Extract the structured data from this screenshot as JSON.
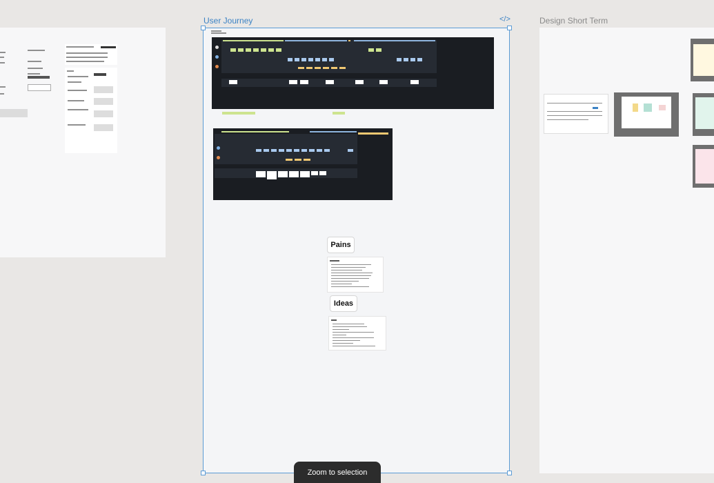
{
  "frames": {
    "user_journey": {
      "label": "User Journey"
    },
    "design_short_term": {
      "label": "Design Short Term"
    }
  },
  "stickies": {
    "pains": "Pains",
    "ideas": "Ideas"
  },
  "toolbar": {
    "zoom_label": "Zoom to selection"
  },
  "icons": {
    "code": "code-icon"
  },
  "colors": {
    "canvas": "#e9e7e5",
    "selection": "#5b9bd5",
    "dark_board": "#1a1d22"
  }
}
